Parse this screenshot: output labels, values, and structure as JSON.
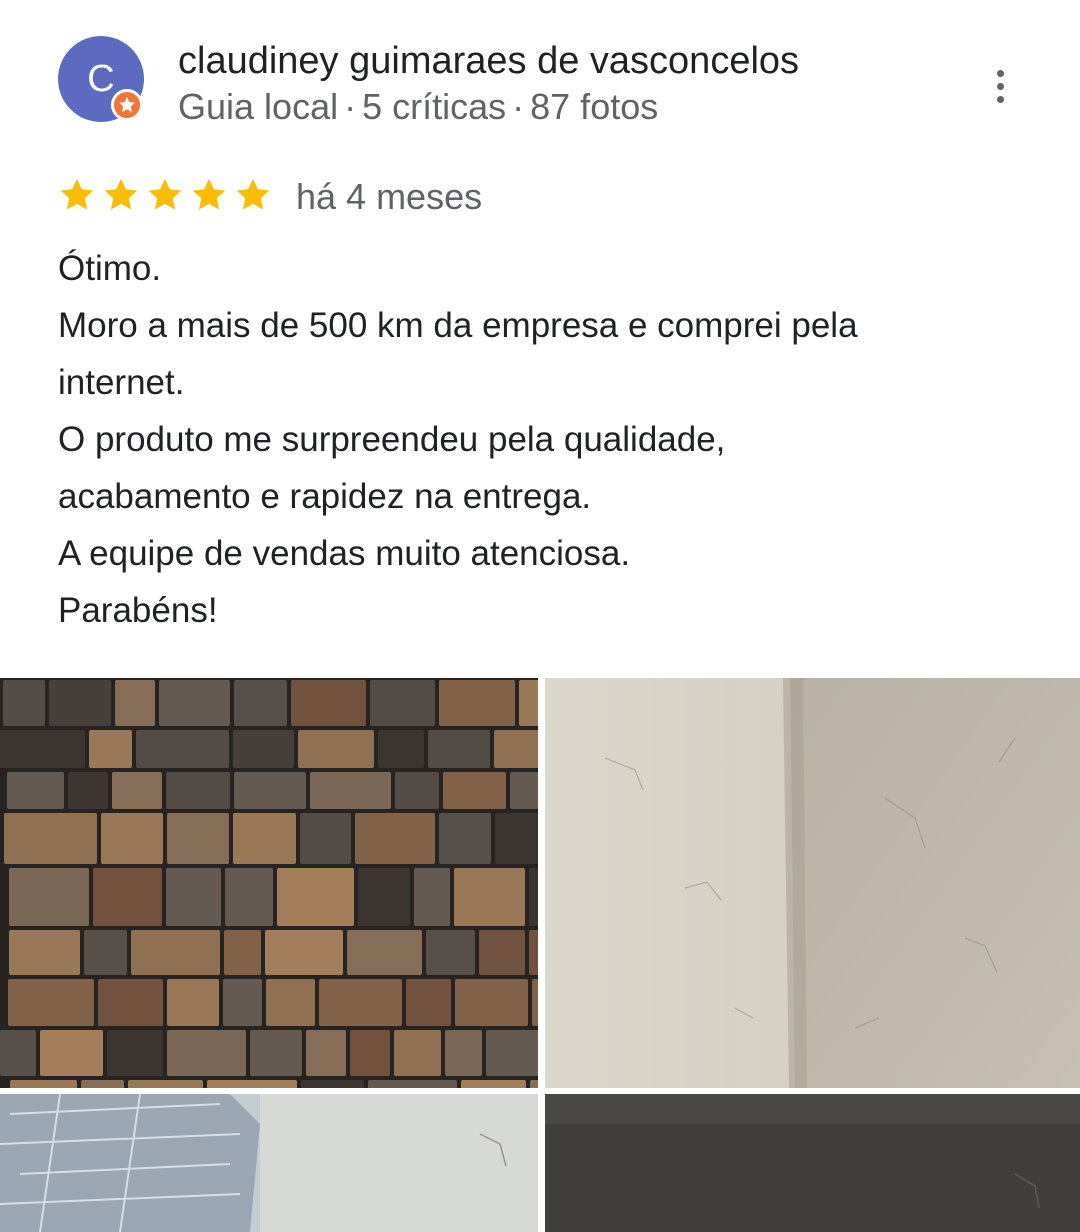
{
  "author": {
    "avatar_initial": "C",
    "avatar_color": "#5c6bc0",
    "badge_color": "#f0763a",
    "name": "claudiney guimaraes de vasconcelos",
    "level": "Guia local",
    "reviews_count": "5 críticas",
    "photos_count": "87 fotos",
    "separator": "·"
  },
  "review": {
    "rating": 5,
    "max_rating": 5,
    "star_color": "#fbbc04",
    "date": "há 4 meses",
    "lines": [
      "Ótimo.",
      "Moro a mais de 500 km da empresa e comprei pela",
      "internet.",
      "O produto me surpreendeu pela qualidade,",
      "acabamento e rapidez na entrega.",
      "A equipe de vendas muito atenciosa.",
      "Parabéns!"
    ]
  },
  "icons": {
    "menu": "more-vert-icon",
    "badge": "local-guide-star-icon",
    "rating": "star-icon"
  }
}
